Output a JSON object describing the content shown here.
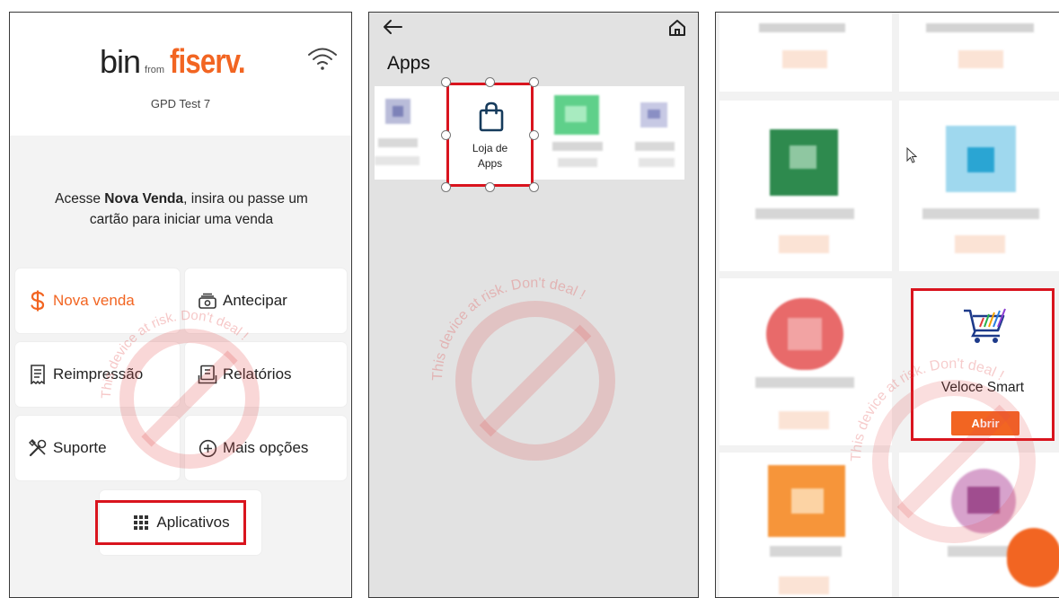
{
  "panel1": {
    "logo": {
      "bin": "bin",
      "from": "from",
      "fiserv": "fiserv."
    },
    "device_name": "GPD Test 7",
    "instructions": {
      "pre": "Acesse ",
      "bold": "Nova Venda",
      "post": ", insira ou passe um cartão para iniciar uma venda"
    },
    "tiles": {
      "nova_venda": "Nova venda",
      "antecipar": "Antecipar",
      "reimpressao": "Reimpressão",
      "relatorios": "Relatórios",
      "suporte": "Suporte",
      "mais_opcoes": "Mais opções",
      "aplicativos": "Aplicativos"
    },
    "icons": {
      "nova_venda": "dollar-icon",
      "antecipar": "cash-stack-icon",
      "reimpressao": "receipt-icon",
      "relatorios": "report-icon",
      "suporte": "tools-icon",
      "mais_opcoes": "plus-circle-icon",
      "aplicativos": "grid-icon",
      "status": "wifi-icon"
    }
  },
  "panel2": {
    "title": "Apps",
    "loja_label_line1": "Loja de",
    "loja_label_line2": "Apps",
    "icons": {
      "back": "back-arrow-icon",
      "home": "home-icon",
      "loja": "shopping-bag-icon"
    }
  },
  "panel3": {
    "app_name": "Veloce Smart",
    "open_button": "Abrir",
    "icons": {
      "app": "shopping-cart-icon",
      "cursor": "mouse-cursor-icon"
    }
  },
  "watermark_text": "This device at risk. Don't deal !",
  "colors": {
    "brand_orange": "#f26522",
    "highlight_red": "#d9141e",
    "watermark_red": "#e24a4a"
  }
}
